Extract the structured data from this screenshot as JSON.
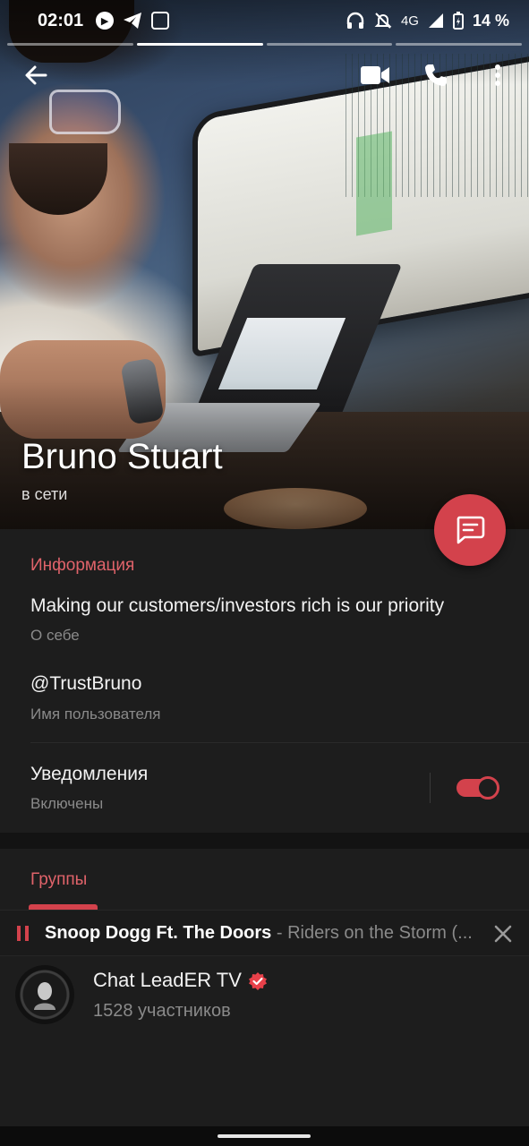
{
  "status_bar": {
    "time": "02:01",
    "network": "4G",
    "battery": "14 %",
    "icons": [
      "play-circle-icon",
      "telegram-icon",
      "screen-record-icon",
      "headphones-icon",
      "bell-off-icon",
      "signal-icon",
      "battery-charging-icon"
    ]
  },
  "story_progress": {
    "segments": 4,
    "active_index": 1
  },
  "toolbar": {
    "back_icon": "arrow-left-icon",
    "video_icon": "video-call-icon",
    "call_icon": "phone-icon",
    "menu_icon": "more-vert-icon"
  },
  "profile": {
    "name": "Bruno Stuart",
    "status": "в сети"
  },
  "fab": {
    "icon": "message-icon",
    "color": "#d3424c"
  },
  "info": {
    "section_title": "Информация",
    "bio": "Making our customers/investors rich is our priority",
    "bio_label": "О себе",
    "username": "@TrustBruno",
    "username_label": "Имя пользователя",
    "notifications": "Уведомления",
    "notifications_state": "Включены",
    "notifications_on": true
  },
  "groups": {
    "section_title": "Группы"
  },
  "player": {
    "artist": "Snoop Dogg Ft. The Doors",
    "title": " - Riders on the Storm (...",
    "state": "playing"
  },
  "group_list": [
    {
      "name": "Chat LeadER TV",
      "members": "1528 участников",
      "verified": true
    }
  ],
  "colors": {
    "accent": "#d3424c",
    "section_title": "#e0636a",
    "background": "#1d1d1d",
    "secondary_text": "#8a8a8a"
  }
}
